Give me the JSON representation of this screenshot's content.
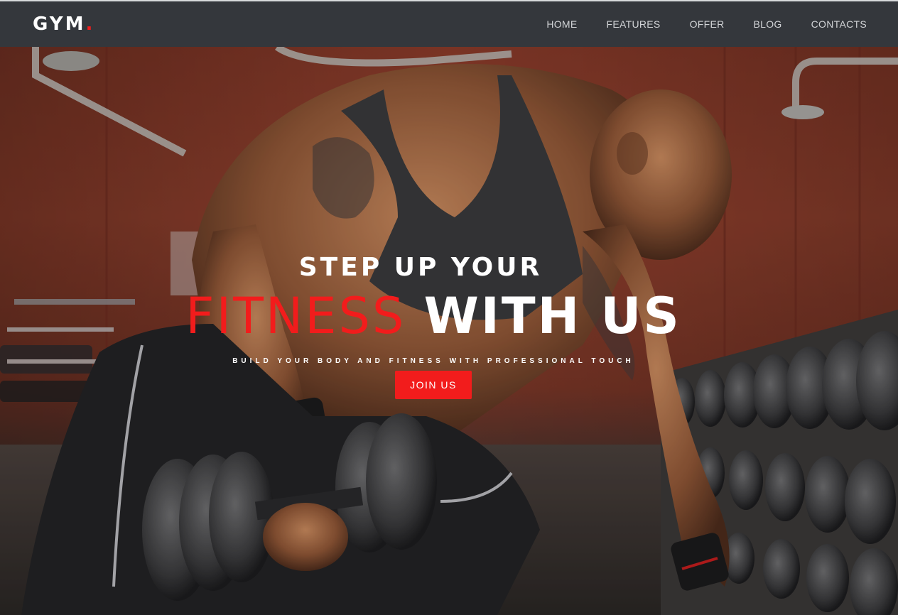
{
  "brand": {
    "name": "GYM",
    "dot": ".",
    "accent_color": "#f21d1d"
  },
  "nav": {
    "items": [
      {
        "label": "HOME"
      },
      {
        "label": "FEATURES"
      },
      {
        "label": "OFFER"
      },
      {
        "label": "BLOG"
      },
      {
        "label": "CONTACTS"
      }
    ]
  },
  "hero": {
    "eyebrow": "STEP UP YOUR",
    "headline_red": "FITNESS",
    "headline_white": "WITH US",
    "subline": "BUILD YOUR BODY AND FITNESS WITH PROFESSIONAL TOUCH",
    "cta_label": "JOIN US",
    "cta_color": "#f21c1c"
  }
}
